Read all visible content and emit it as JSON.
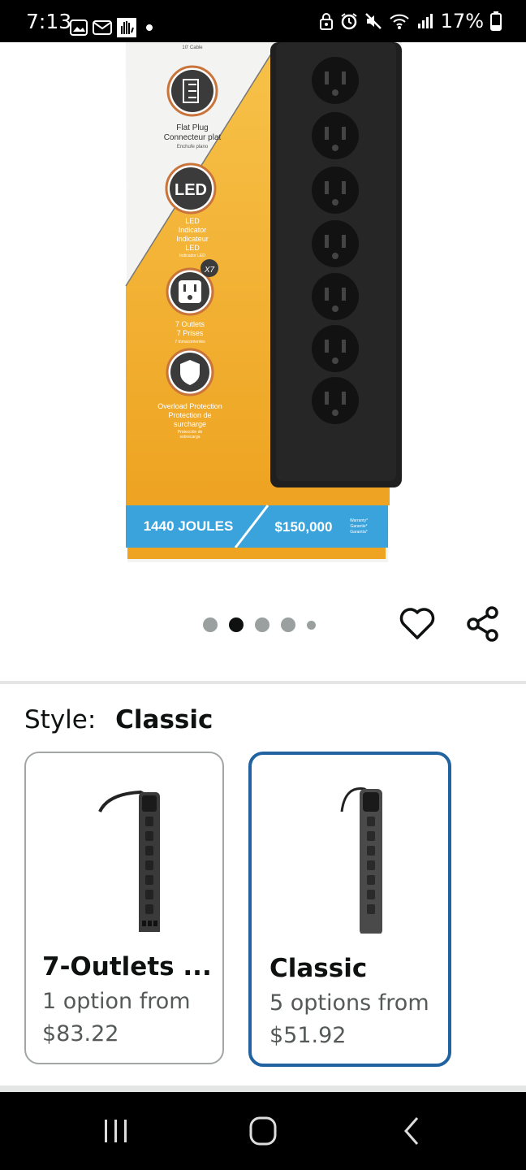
{
  "status_bar": {
    "time": "7:13",
    "battery_percent": "17%",
    "icons_left": [
      "gallery-icon",
      "mail-icon",
      "hand-icon",
      "dot-icon"
    ],
    "icons_right": [
      "lock-icon",
      "alarm-icon",
      "mute-icon",
      "wifi-icon",
      "signal-icon",
      "battery-icon"
    ]
  },
  "product_image": {
    "labels": {
      "cable": "10' Cable",
      "flat_plug_1": "Flat Plug",
      "flat_plug_2": "Connecteur plat",
      "flat_plug_3": "Enchufe plano",
      "led_badge": "LED",
      "led_1": "LED",
      "led_2": "Indicator",
      "led_3": "Indicateur",
      "led_4": "LED",
      "led_5": "Indicador LED",
      "outlets_badge": "X7",
      "outlets_1": "7 Outlets",
      "outlets_2": "7 Prises",
      "outlets_3": "7 tomacorrientes",
      "overload_1": "Overload Protection",
      "overload_2": "Protection de",
      "overload_3": "surcharge",
      "overload_4": "Protección de",
      "overload_5": "sobrecarga",
      "joules": "1440 JOULES",
      "warranty_amount": "$150,000",
      "warranty_1": "Warranty*",
      "warranty_2": "Garantie*",
      "warranty_3": "Garantía*"
    },
    "carousel_count": 5,
    "carousel_active_index": 1
  },
  "style_selector": {
    "label": "Style:",
    "selected_value": "Classic",
    "options": [
      {
        "title": "7-Outlets ...",
        "subtitle": "1 option from",
        "price": "$83.22",
        "selected": false
      },
      {
        "title": "Classic",
        "subtitle": "5 options from",
        "price": "$51.92",
        "selected": true
      }
    ]
  },
  "colors": {
    "selected_border": "#2162a1",
    "box_yellow": "#f3b22a",
    "box_blue": "#3ba3dc",
    "strip_black": "#1f1f1f"
  },
  "nav_bar": {
    "buttons": [
      "recent-apps-icon",
      "home-icon",
      "back-icon"
    ]
  }
}
